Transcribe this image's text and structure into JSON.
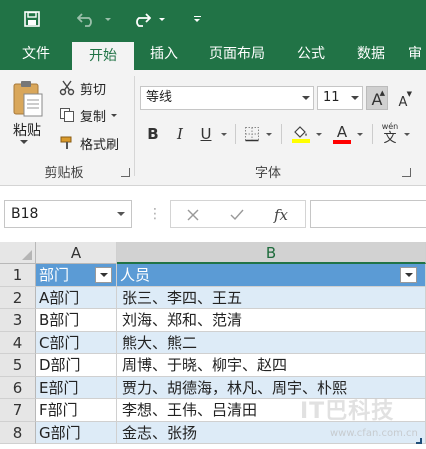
{
  "quick_access": {
    "save_icon": "save-icon",
    "undo_icon": "undo-icon",
    "redo_icon": "redo-icon",
    "customize_icon": "customize-qat-icon"
  },
  "tabs": [
    {
      "label": "文件"
    },
    {
      "label": "开始"
    },
    {
      "label": "插入"
    },
    {
      "label": "页面布局"
    },
    {
      "label": "公式"
    },
    {
      "label": "数据"
    },
    {
      "label": "审"
    }
  ],
  "ribbon": {
    "clipboard": {
      "paste_label": "粘贴",
      "cut_label": "剪切",
      "copy_label": "复制",
      "format_painter_label": "格式刷",
      "group_label": "剪贴板"
    },
    "font": {
      "font_name": "等线",
      "font_size": "11",
      "bold": "B",
      "italic": "I",
      "underline": "U",
      "grow_font": "A",
      "shrink_font": "A",
      "phonetic": "wén",
      "phonetic_char": "文",
      "group_label": "字体",
      "fill_color": "#FFFF00",
      "font_color": "#FF0000"
    }
  },
  "formula_bar": {
    "name_box": "B18",
    "fx_label": "fx"
  },
  "grid": {
    "columns": [
      "A",
      "B"
    ],
    "rows": [
      {
        "num": "1",
        "a": "部门",
        "b": "人员"
      },
      {
        "num": "2",
        "a": "A部门",
        "b": "张三、李四、王五"
      },
      {
        "num": "3",
        "a": "B部门",
        "b": "刘海、郑和、范清"
      },
      {
        "num": "4",
        "a": "C部门",
        "b": "熊大、熊二"
      },
      {
        "num": "5",
        "a": "D部门",
        "b": "周博、于晓、柳宇、赵四"
      },
      {
        "num": "6",
        "a": "E部门",
        "b": "贾力、胡德海，林凡、周宇、朴熙"
      },
      {
        "num": "7",
        "a": "F部门",
        "b": "李想、王伟、吕清田"
      },
      {
        "num": "8",
        "a": "G部门",
        "b": "金志、张扬"
      }
    ],
    "header_color": "#5B9BD5",
    "band_color": "#DDEBF7"
  },
  "watermark": {
    "text": "IT巴科技",
    "subtext": "www.cfan.com.cn"
  }
}
